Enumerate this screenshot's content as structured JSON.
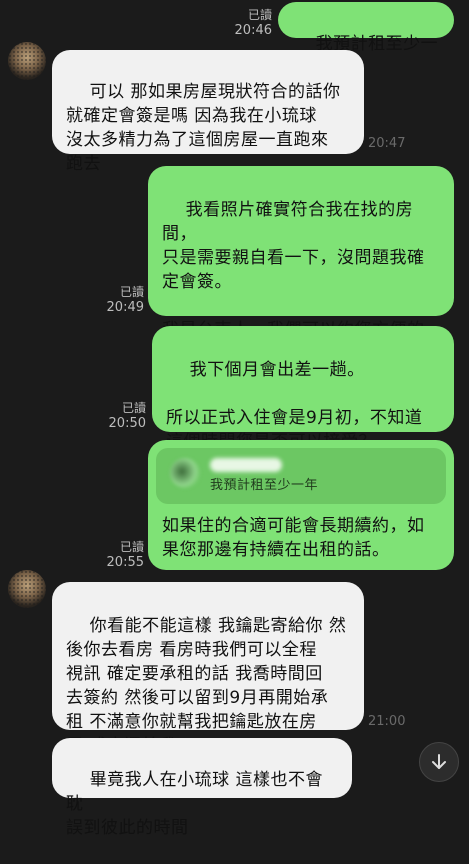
{
  "messages": {
    "m1": {
      "read": "已讀",
      "time": "20:46",
      "text": "我預計租至少一年"
    },
    "m2": {
      "time": "20:47",
      "text": "可以 那如果房屋現狀符合的話你\n就確定會簽是嗎 因為我在小琉球\n沒太多精力為了這個房屋一直跑來\n跑去"
    },
    "m3": {
      "read": "已讀",
      "time": "20:49",
      "text": "我看照片確實符合我在找的房間，\n只是需要親自看一下，沒問題我確\n定會簽。\n\n我是台南人，我們可以約您方便的\n時間，我上台北一趟看實際屋況。"
    },
    "m4": {
      "read": "已讀",
      "time": "20:50",
      "text": "我下個月會出差一趟。\n\n所以正式入住會是9月初，不知道\n這個時間您是否可以接受？"
    },
    "m5": {
      "read": "已讀",
      "time": "20:55",
      "quoted": "我預計租至少一年",
      "text": "如果住的合適可能會長期續約，如\n果您那邊有持續在出租的話。"
    },
    "m6": {
      "time": "21:00",
      "text": "你看能不能這樣 我鑰匙寄給你 然\n後你去看房 看房時我們可以全程\n視訊 確定要承租的話 我喬時間回\n去簽約 然後可以留到9月再開始承\n租 不滿意你就幫我把鑰匙放在房\n屋 或寄還給我"
    },
    "m7": {
      "text": "畢竟我人在小琉球 這樣也不會耽\n誤到彼此的時間"
    }
  },
  "icons": {
    "scroll_down": "chevron-down-icon"
  },
  "colors": {
    "sent_bubble": "#7fe276",
    "received_bubble": "#f1f1f1",
    "background": "#1b1b1b"
  }
}
